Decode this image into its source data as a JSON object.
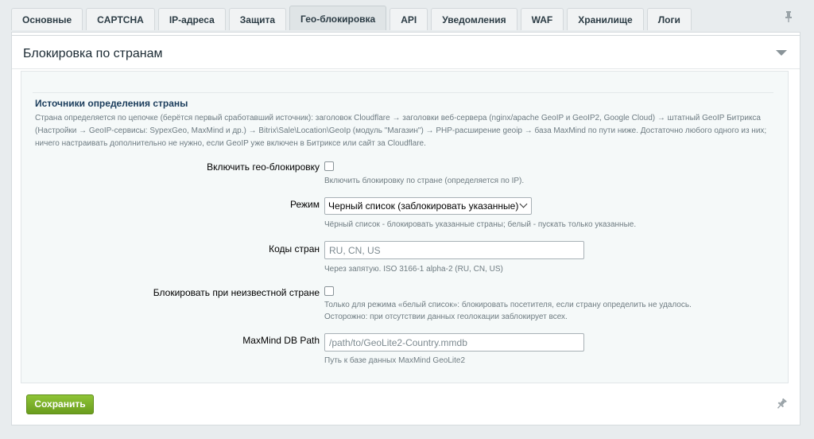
{
  "tabs": [
    {
      "label": "Основные"
    },
    {
      "label": "CAPTCHA"
    },
    {
      "label": "IP-адреса"
    },
    {
      "label": "Защита"
    },
    {
      "label": "Гео-блокировка"
    },
    {
      "label": "API"
    },
    {
      "label": "Уведомления"
    },
    {
      "label": "WAF"
    },
    {
      "label": "Хранилище"
    },
    {
      "label": "Логи"
    }
  ],
  "active_tab": "Гео-блокировка",
  "panel": {
    "title": "Блокировка по странам"
  },
  "section": {
    "title": "Источники определения страны",
    "description": "Страна определяется по цепочке (берётся первый сработавший источник): заголовок Cloudflare → заголовки веб-сервера (nginx/apache GeoIP и GeoIP2, Google Cloud) → штатный GeoIP Битрикса (Настройки → GeoIP-сервисы: SypexGeo, MaxMind и др.) → Bitrix\\Sale\\Location\\GeoIp (модуль \"Магазин\") → PHP-расширение geoip → база MaxMind по пути ниже. Достаточно любого одного из них; ничего настраивать дополнительно не нужно, если GeoIP уже включен в Битриксе или сайт за Cloudflare."
  },
  "fields": {
    "enable": {
      "label": "Включить гео-блокировку",
      "checked": false,
      "hint": "Включить блокировку по стране (определяется по IP)."
    },
    "mode": {
      "label": "Режим",
      "value": "Черный список (заблокировать указанные)",
      "hint": "Чёрный список - блокировать указанные страны; белый - пускать только указанные."
    },
    "codes": {
      "label": "Коды стран",
      "placeholder": "RU, CN, US",
      "value": "",
      "hint": "Через запятую. ISO 3166-1 alpha-2 (RU, CN, US)"
    },
    "unknown": {
      "label": "Блокировать при неизвестной стране",
      "checked": false,
      "hint_line1": "Только для режима «белый список»: блокировать посетителя, если страну определить не удалось.",
      "hint_line2": "Осторожно: при отсутствии данных геолокации заблокирует всех."
    },
    "maxmind": {
      "label": "MaxMind DB Path",
      "placeholder": "/path/to/GeoLite2-Country.mmdb",
      "hint": "Путь к базе данных MaxMind GeoLite2"
    }
  },
  "buttons": {
    "save": "Сохранить"
  },
  "icons": {
    "pin": "pin-icon",
    "collapse": "collapse-arrow-icon"
  },
  "colors": {
    "save_button": "#7ab12a",
    "section_title": "#1b3d5c"
  }
}
